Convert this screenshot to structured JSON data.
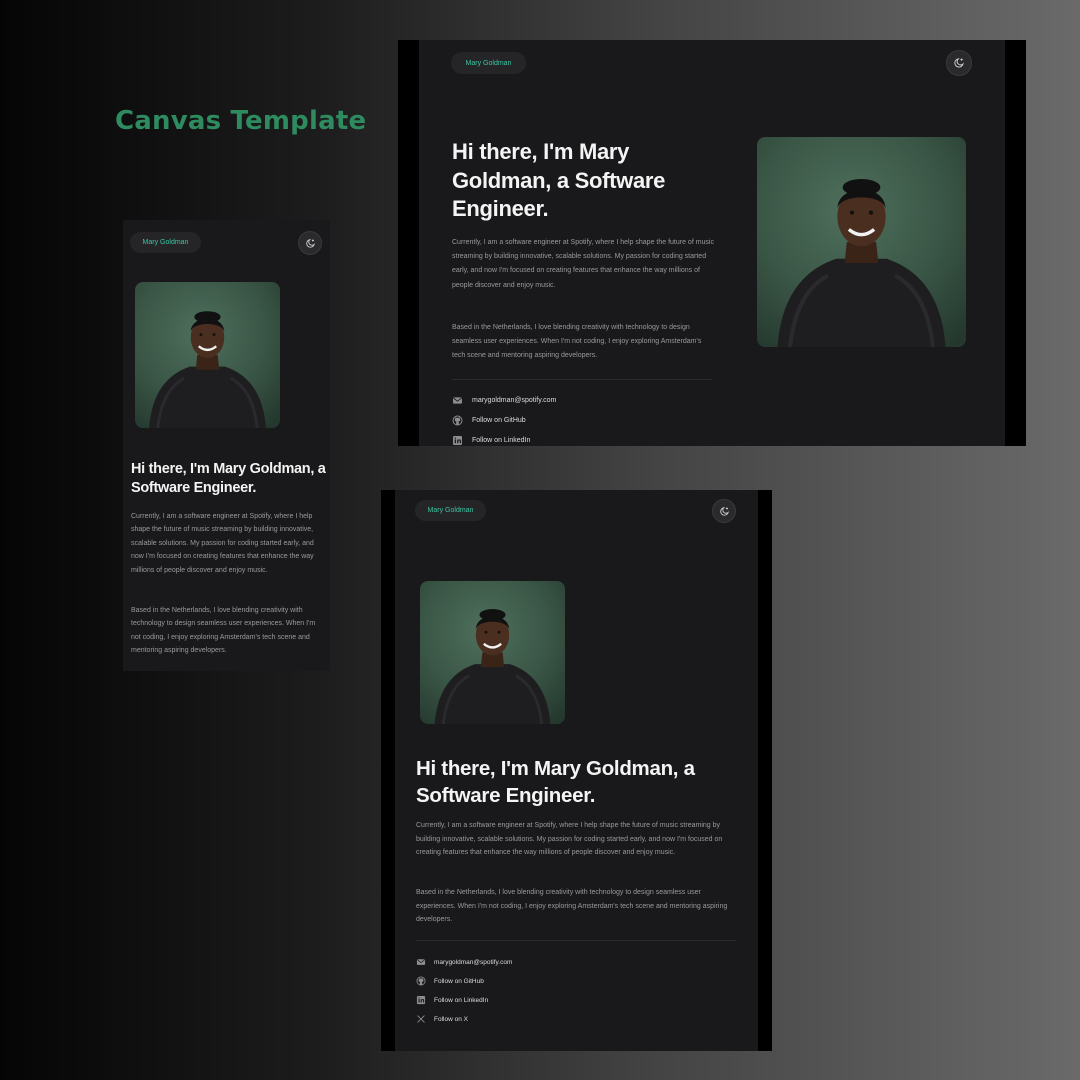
{
  "canvas_title": "Canvas Template",
  "site": {
    "name_pill": "Mary Goldman",
    "headline": "Hi there, I'm Mary Goldman, a Software Engineer.",
    "headline_desktop_lines": [
      "Hi there, I'm Mary",
      "Goldman, a Software",
      "Engineer."
    ],
    "paragraph_1": "Currently, I am a software engineer at Spotify, where I help shape the future of music streaming by building innovative, scalable solutions. My passion for coding started early, and now I'm focused on creating features that enhance the way millions of people discover and enjoy music.",
    "paragraph_2": "Based in the Netherlands, I love blending creativity with technology to design seamless user experiences. When I'm not coding, I enjoy exploring Amsterdam's tech scene and mentoring aspiring developers.",
    "contacts": {
      "email": "marygoldman@spotify.com",
      "github": "Follow on GitHub",
      "linkedin": "Follow on LinkedIn",
      "x": "Follow on X"
    }
  },
  "icons": {
    "theme": "moon-sparkle-icon",
    "email": "mail-icon",
    "github": "github-icon",
    "linkedin": "linkedin-icon",
    "x": "x-icon"
  },
  "colors": {
    "title_green": "#2e8a5f",
    "pill_text": "#3cc6a4",
    "frame_bg": "#19191b"
  }
}
